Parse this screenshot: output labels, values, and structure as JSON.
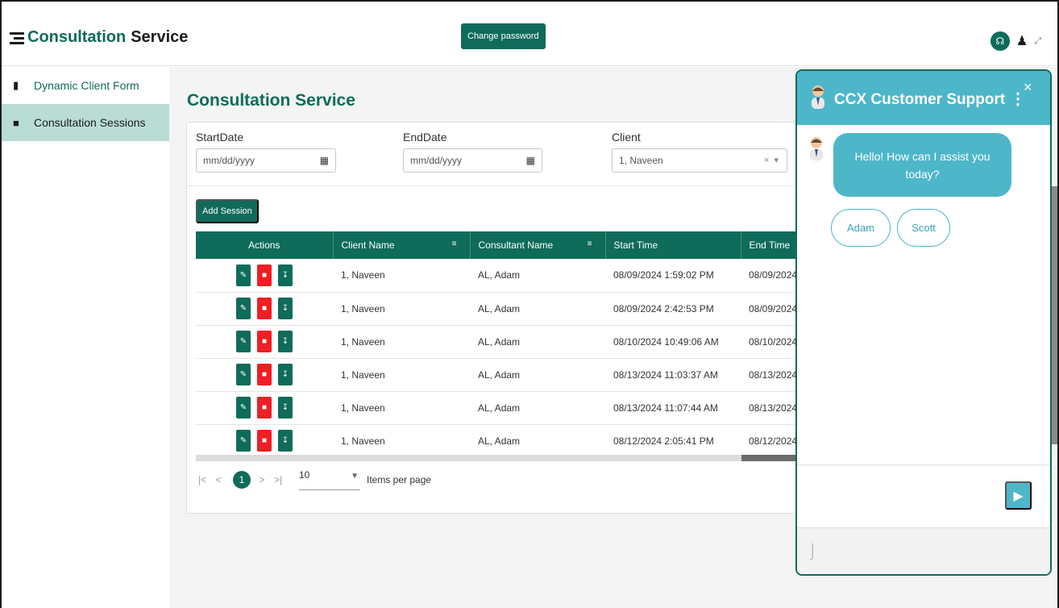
{
  "header": {
    "brand_primary": "Consultation",
    "brand_secondary": "Service",
    "change_password_label": "Change password",
    "icons": [
      "menu-icon",
      "headset-icon",
      "user-icon",
      "expand-icon"
    ]
  },
  "sidebar": {
    "items": [
      {
        "label": "Dynamic Client Form",
        "icon": "book-icon"
      },
      {
        "label": "Consultation Sessions",
        "icon": "file-icon",
        "active": true
      }
    ]
  },
  "main": {
    "title": "Consultation Service",
    "filters": {
      "start_label": "StartDate",
      "start_placeholder": "mm/dd/yyyy",
      "end_label": "EndDate",
      "end_placeholder": "mm/dd/yyyy",
      "client_label": "Client",
      "client_value": "1, Naveen",
      "clear_symbol": "×",
      "dropdown_symbol": "▾"
    },
    "add_session_label": "Add Session",
    "table": {
      "headers": [
        "Actions",
        "Client Name",
        "Consultant Name",
        "Start Time",
        "End Time"
      ],
      "rows": [
        {
          "client": "1, Naveen",
          "consultant": "AL, Adam",
          "start": "08/09/2024 1:59:02 PM",
          "end": "08/09/2024"
        },
        {
          "client": "1, Naveen",
          "consultant": "AL, Adam",
          "start": "08/09/2024 2:42:53 PM",
          "end": "08/09/2024"
        },
        {
          "client": "1, Naveen",
          "consultant": "AL, Adam",
          "start": "08/10/2024 10:49:06 AM",
          "end": "08/10/2024"
        },
        {
          "client": "1, Naveen",
          "consultant": "AL, Adam",
          "start": "08/13/2024 11:03:37 AM",
          "end": "08/13/2024"
        },
        {
          "client": "1, Naveen",
          "consultant": "AL, Adam",
          "start": "08/13/2024 11:07:44 AM",
          "end": "08/13/2024"
        },
        {
          "client": "1, Naveen",
          "consultant": "AL, Adam",
          "start": "08/12/2024 2:05:41 PM",
          "end": "08/12/2024"
        }
      ]
    },
    "pager": {
      "current_page": "1",
      "items_per_page": "10",
      "items_per_page_label": "Items per page"
    }
  },
  "chat": {
    "title": "CCX Customer Support",
    "menu_symbol": "⋮",
    "close_symbol": "×",
    "greeting": "Hello! How can I assist you today?",
    "options": [
      "Adam",
      "Scott"
    ],
    "send_icon": "send-icon",
    "attach_icon": "paperclip-icon"
  },
  "colors": {
    "brand_green": "#0f6b5a",
    "chat_blue": "#4eb6c9",
    "delete_red": "#ee1f25",
    "sidebar_active": "#b9dcd5"
  }
}
